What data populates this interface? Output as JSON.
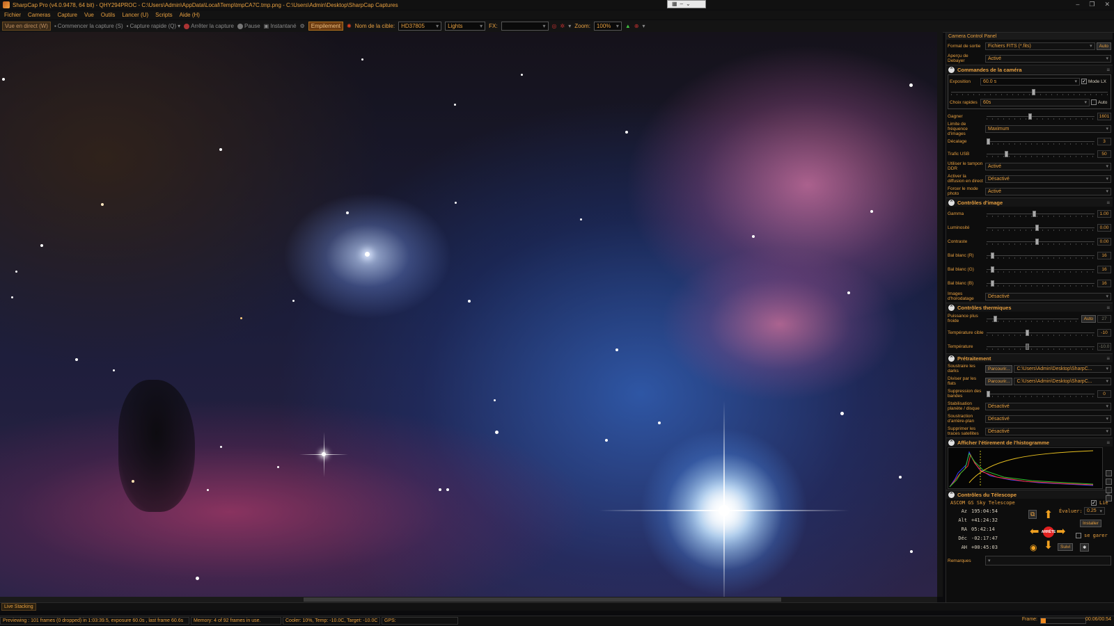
{
  "window": {
    "title": "SharpCap Pro (v4.0.9478, 64 bit) - QHY294PROC - C:\\Users\\Admin\\AppData\\Local\\Temp\\tmpCA7C.tmp.png - C:\\Users\\Admin\\Desktop\\SharpCap Captures"
  },
  "menu": [
    "Fichier",
    "Cameras",
    "Capture",
    "Vue",
    "Outils",
    "Lancer (U)",
    "Scripts",
    "Aide (H)"
  ],
  "toolbar": {
    "live_view": "Vue en direct (W)",
    "start_capture": "Commencer la capture (S)",
    "quick_capture": "Capture rapide (Q)",
    "stop_capture": "Arrêter la capture",
    "pause": "Pause",
    "snapshot": "Instantané",
    "stacking": "Empilement",
    "target_label": "Nom de la cible:",
    "target_value": "HD37805",
    "frame_type": "Lights",
    "fx_label": "FX:",
    "fx_value": "",
    "zoom_label": "Zoom:",
    "zoom_value": "100%"
  },
  "panel": {
    "title": "Camera Control Panel",
    "output_label": "Format de sortie",
    "output_value": "Fichiers FITS (*.fits)",
    "output_auto": "Auto",
    "debayer_label": "Aperçu de Debayer",
    "debayer_value": "Activé",
    "camera_section": "Commandes de la caméra",
    "exposure_label": "Exposition",
    "exposure_value": "60.0 s",
    "lx_mode": "Mode LX",
    "quick_label": "Choix rapides",
    "quick_value": "60s",
    "quick_auto": "Auto",
    "gain_label": "Gagner",
    "gain_value": "1601",
    "fps_label": "Limite de fréquence d'images",
    "fps_value": "Maximum",
    "offset_label": "Décalage",
    "offset_value": "3",
    "usb_label": "Trafic USB",
    "usb_value": "50",
    "ddr_label": "Utiliser le tampon DDR",
    "ddr_value": "Activé",
    "live_diff_label": "Activer la diffusion en direct",
    "live_diff_value": "Désactivé",
    "photo_label": "Forcer le mode photo",
    "photo_value": "Activé",
    "image_section": "Contrôles d'image",
    "gamma_label": "Gamma",
    "gamma_value": "1.00",
    "brightness_label": "Luminosité",
    "brightness_value": "0.00",
    "contrast_label": "Contraste",
    "contrast_value": "0.00",
    "wbr_label": "Bal blanc (R)",
    "wbr_value": "16",
    "wbg_label": "Bal blanc (G)",
    "wbg_value": "16",
    "wbb_label": "Bal blanc (B)",
    "wbb_value": "16",
    "timestamp_label": "Images d'horodatage",
    "timestamp_value": "Désactivé",
    "thermal_section": "Contrôles thermiques",
    "cold_label": "Puissance plus froide",
    "cold_auto": "Auto",
    "cold_value": "27",
    "target_temp_label": "Température cible",
    "target_temp_value": "-10",
    "temp_label": "Température",
    "temp_value": "-10.0",
    "preproc_section": "Prétraitement",
    "darks_label": "Soustraire les darks",
    "browse": "Parcourir...",
    "darks_value": "C:\\Users\\Admin\\Desktop\\SharpC...",
    "flats_label": "Diviser par les flats",
    "flats_value": "C:\\Users\\Admin\\Desktop\\SharpC...",
    "banding_label": "Suppression des bandes",
    "banding_value": "0",
    "stab_label": "Stabilisation planète / disque",
    "stab_value": "Désactivé",
    "bg_label": "Soustraction d'arrière-plan",
    "bg_value": "Désactivé",
    "sat_label": "Supprimer les traces satellites",
    "sat_value": "Désactivé",
    "histo_section": "Afficher l'étirement de l'histogramme",
    "scope_section": "Contrôles du Télescope",
    "scope_name": "ASCOM GS Sky Telescope",
    "linked": "Lié",
    "az_label": "Az",
    "az_value": "195:04:54",
    "alt_label": "Alt",
    "alt_value": "+41:24:32",
    "ra_label": "RA",
    "ra_value": "05:42:14",
    "dec_label": "Déc",
    "dec_value": "-02:17:47",
    "ah_label": "AH",
    "ah_value": "+00:45:03",
    "rate_label": "Évaluer:",
    "rate_value": "0.25",
    "install": "Installer",
    "park": "se garer",
    "stop": "ARRÊTE",
    "track": "Suivi",
    "notes_label": "Remarques"
  },
  "bottom": {
    "live_stacking_tab": "Live Stacking",
    "status_preview": "Previewing : 101 frames (0 dropped) in 1:03:39.5, exposure 60.0s , last frame 60.6s",
    "status_memory": "Memory: 4 of 92 frames in use.",
    "status_cooler": "Cooler: 10%, Temp: -10.0C, Target: -10.0C",
    "status_gps": "GPS:",
    "frame_label": "Frame:",
    "frame_time": "00:06/00:54",
    "frame_progress": 0.11
  },
  "colors": {
    "accent": "#e8a040",
    "stack_active": "#6a3a10",
    "stop_red": "#e02020"
  }
}
